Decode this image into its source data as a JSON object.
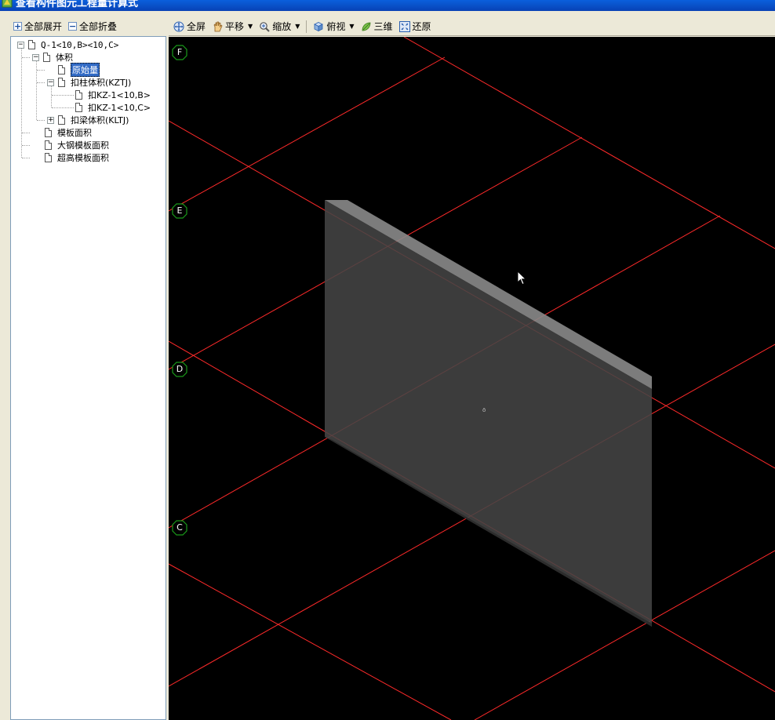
{
  "window": {
    "title": "查看构件图元工程量计算式"
  },
  "left_toolbar": {
    "expand_all": "全部展开",
    "collapse_all": "全部折叠"
  },
  "tree": {
    "root": "Q-1<10,B><10,C>",
    "volume": "体积",
    "original": "原始量",
    "deduct_column": "扣柱体积(KZTJ)",
    "kz_b": "扣KZ-1<10,B>",
    "kz_c": "扣KZ-1<10,C>",
    "deduct_beam": "扣梁体积(KLTJ)",
    "formwork": "模板面积",
    "steel_formwork": "大钢模板面积",
    "high_formwork": "超高模板面积"
  },
  "view_toolbar": {
    "fullscreen": "全屏",
    "pan": "平移",
    "zoom": "缩放",
    "view": "俯视",
    "three_d": "三维",
    "restore": "还原"
  },
  "axes": [
    "F",
    "E",
    "D",
    "C"
  ],
  "colors": {
    "grid": "#ff2a2a",
    "axis_circle": "#1a9a1a",
    "wall_face": "#3d3d3d",
    "wall_top": "#8a8a8a",
    "wall_side": "#2a2a2a",
    "selection": "#316ac5"
  },
  "icons": [
    "app-icon",
    "expand-icon",
    "collapse-icon",
    "fullscreen-icon",
    "pan-icon",
    "zoom-icon",
    "view-cube-icon",
    "three-d-icon",
    "restore-icon",
    "cursor-icon"
  ]
}
